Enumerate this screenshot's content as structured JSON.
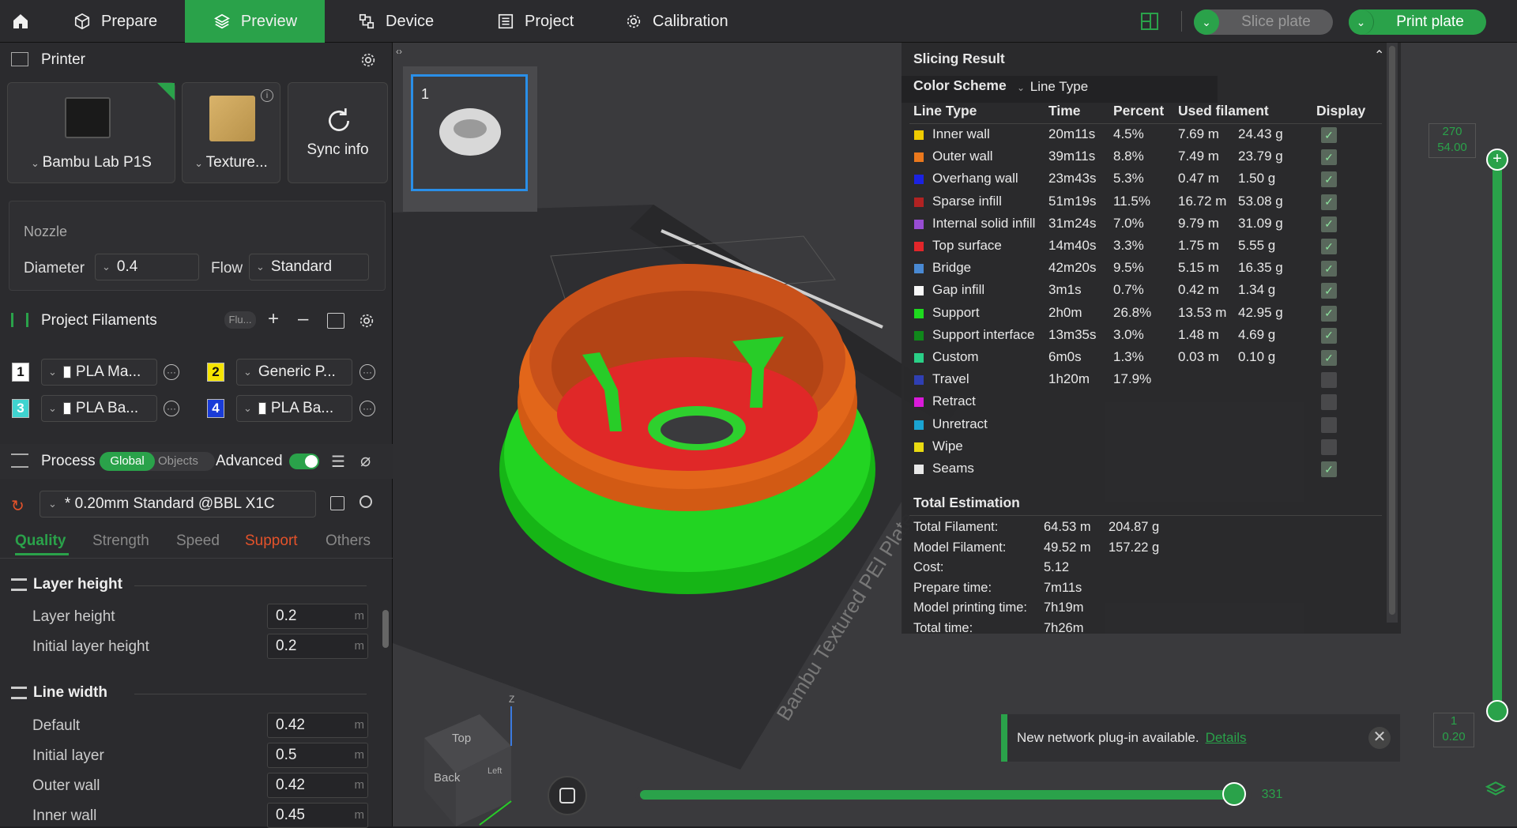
{
  "nav": {
    "home_icon": "home-icon",
    "tabs": [
      {
        "label": "Prepare",
        "icon": "cube-icon"
      },
      {
        "label": "Preview",
        "icon": "layers-icon"
      },
      {
        "label": "Device",
        "icon": "device-icon"
      },
      {
        "label": "Project",
        "icon": "list-icon"
      },
      {
        "label": "Calibration",
        "icon": "gear-icon"
      }
    ],
    "slice_label": "Slice plate",
    "print_label": "Print plate"
  },
  "printer": {
    "title": "Printer",
    "machine": "Bambu Lab P1S",
    "plate": "Texture...",
    "sync": "Sync info",
    "nozzle_label": "Nozzle",
    "diameter_label": "Diameter",
    "diameter_value": "0.4",
    "flow_label": "Flow",
    "flow_value": "Standard"
  },
  "filaments": {
    "title": "Project Filaments",
    "flush_label": "Flu...",
    "items": [
      {
        "num": "1",
        "name": "PLA Ma...",
        "color": "#ffffff",
        "text": "#111111"
      },
      {
        "num": "2",
        "name": "Generic P...",
        "color": "#f5e400",
        "text": "#111111"
      },
      {
        "num": "3",
        "name": "PLA Ba...",
        "color": "#3fd4d0",
        "text": "#ffffff"
      },
      {
        "num": "4",
        "name": "PLA Ba...",
        "color": "#1a3cd8",
        "text": "#ffffff"
      }
    ]
  },
  "process": {
    "title": "Process",
    "global": "Global",
    "objects": "Objects",
    "advanced": "Advanced",
    "preset": "* 0.20mm Standard @BBL X1C",
    "tabs": [
      "Quality",
      "Strength",
      "Speed",
      "Support",
      "Others"
    ],
    "layer_group": "Layer height",
    "layer_height_label": "Layer height",
    "layer_height": "0.2",
    "initial_layer_height_label": "Initial layer height",
    "initial_layer_height": "0.2",
    "line_group": "Line width",
    "default_label": "Default",
    "default_value": "0.42",
    "initial_layer_label": "Initial layer",
    "initial_layer_value": "0.5",
    "outer_wall_label": "Outer wall",
    "outer_wall_value": "0.42",
    "inner_wall_label": "Inner wall",
    "inner_wall_value": "0.45",
    "unit": "m"
  },
  "plate": {
    "number": "1"
  },
  "bed_label": "Bambu Textured PEI Plate",
  "view_cube": {
    "top": "Top",
    "back": "Back",
    "left": "Left",
    "axis_z": "Z"
  },
  "slicing": {
    "title": "Slicing Result",
    "color_scheme_label": "Color Scheme",
    "color_scheme_value": "Line Type",
    "headers": {
      "type": "Line Type",
      "time": "Time",
      "percent": "Percent",
      "used": "Used filament",
      "display": "Display"
    },
    "rows": [
      {
        "name": "Inner wall",
        "color": "#f5d000",
        "time": "20m11s",
        "percent": "4.5%",
        "meters": "7.69 m",
        "grams": "24.43 g",
        "display": true
      },
      {
        "name": "Outer wall",
        "color": "#f07a1c",
        "time": "39m11s",
        "percent": "8.8%",
        "meters": "7.49 m",
        "grams": "23.79 g",
        "display": true
      },
      {
        "name": "Overhang wall",
        "color": "#1a22e8",
        "time": "23m43s",
        "percent": "5.3%",
        "meters": "0.47 m",
        "grams": "1.50 g",
        "display": true
      },
      {
        "name": "Sparse infill",
        "color": "#b52222",
        "time": "51m19s",
        "percent": "11.5%",
        "meters": "16.72 m",
        "grams": "53.08 g",
        "display": true
      },
      {
        "name": "Internal solid infill",
        "color": "#9c4ed8",
        "time": "31m24s",
        "percent": "7.0%",
        "meters": "9.79 m",
        "grams": "31.09 g",
        "display": true
      },
      {
        "name": "Top surface",
        "color": "#e8262a",
        "time": "14m40s",
        "percent": "3.3%",
        "meters": "1.75 m",
        "grams": "5.55 g",
        "display": true
      },
      {
        "name": "Bridge",
        "color": "#4a8cd8",
        "time": "42m20s",
        "percent": "9.5%",
        "meters": "5.15 m",
        "grams": "16.35 g",
        "display": true
      },
      {
        "name": "Gap infill",
        "color": "#ffffff",
        "time": "3m1s",
        "percent": "0.7%",
        "meters": "0.42 m",
        "grams": "1.34 g",
        "display": true
      },
      {
        "name": "Support",
        "color": "#1ee01e",
        "time": "2h0m",
        "percent": "26.8%",
        "meters": "13.53 m",
        "grams": "42.95 g",
        "display": true
      },
      {
        "name": "Support interface",
        "color": "#0f8a1a",
        "time": "13m35s",
        "percent": "3.0%",
        "meters": "1.48 m",
        "grams": "4.69 g",
        "display": true
      },
      {
        "name": "Custom",
        "color": "#2ad48a",
        "time": "6m0s",
        "percent": "1.3%",
        "meters": "0.03 m",
        "grams": "0.10 g",
        "display": true
      },
      {
        "name": "Travel",
        "color": "#3040b8",
        "time": "1h20m",
        "percent": "17.9%",
        "meters": "",
        "grams": "",
        "display": false
      },
      {
        "name": "Retract",
        "color": "#e01ae0",
        "time": "",
        "percent": "",
        "meters": "",
        "grams": "",
        "display": false
      },
      {
        "name": "Unretract",
        "color": "#1aa8d8",
        "time": "",
        "percent": "",
        "meters": "",
        "grams": "",
        "display": false
      },
      {
        "name": "Wipe",
        "color": "#f0e010",
        "time": "",
        "percent": "",
        "meters": "",
        "grams": "",
        "display": false
      },
      {
        "name": "Seams",
        "color": "#eeeeee",
        "time": "",
        "percent": "",
        "meters": "",
        "grams": "",
        "display": true
      }
    ],
    "total_title": "Total Estimation",
    "totals": [
      {
        "label": "Total Filament:",
        "v1": "64.53 m",
        "v2": "204.87 g"
      },
      {
        "label": "Model Filament:",
        "v1": "49.52 m",
        "v2": "157.22 g"
      },
      {
        "label": "Cost:",
        "v1": "5.12",
        "v2": ""
      },
      {
        "label": "Prepare time:",
        "v1": "7m11s",
        "v2": ""
      },
      {
        "label": "Model printing time:",
        "v1": "7h19m",
        "v2": ""
      },
      {
        "label": "Total time:",
        "v1": "7h26m",
        "v2": ""
      }
    ]
  },
  "layer_slider": {
    "top_layer": "270",
    "top_height": "54.00",
    "bottom_layer": "1",
    "bottom_height": "0.20"
  },
  "move_slider": {
    "value": "331"
  },
  "notice": {
    "text": "New network plug-in available.",
    "link": "Details"
  }
}
